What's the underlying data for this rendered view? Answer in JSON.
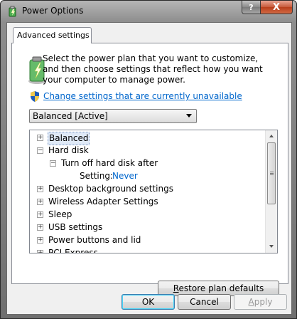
{
  "window": {
    "title": "Power Options",
    "help_label": "?",
    "close_label": "X"
  },
  "tab": {
    "label": "Advanced settings"
  },
  "intro": {
    "text": "Select the power plan that you want to customize, and then choose settings that reflect how you want your computer to manage power."
  },
  "change_link": "Change settings that are currently unavailable",
  "plan_select": {
    "value": "Balanced [Active]"
  },
  "tree": {
    "items": [
      {
        "label": "Balanced",
        "expander": "+"
      },
      {
        "label": "Hard disk",
        "expander": "−"
      },
      {
        "label": "Turn off hard disk after",
        "expander": "−"
      },
      {
        "label": "Setting:",
        "value": "Never"
      },
      {
        "label": "Desktop background settings",
        "expander": "+"
      },
      {
        "label": "Wireless Adapter Settings",
        "expander": "+"
      },
      {
        "label": "Sleep",
        "expander": "+"
      },
      {
        "label": "USB settings",
        "expander": "+"
      },
      {
        "label": "Power buttons and lid",
        "expander": "+"
      },
      {
        "label": "PCI Express",
        "expander": "+"
      }
    ]
  },
  "buttons": {
    "restore_first": "R",
    "restore_rest": "estore plan defaults",
    "ok": "OK",
    "cancel": "Cancel",
    "apply_first": "A",
    "apply_rest": "pply"
  },
  "colors": {
    "link": "#0066cc",
    "selection": "#dfe9f7",
    "close_button": "#c75a3a"
  }
}
